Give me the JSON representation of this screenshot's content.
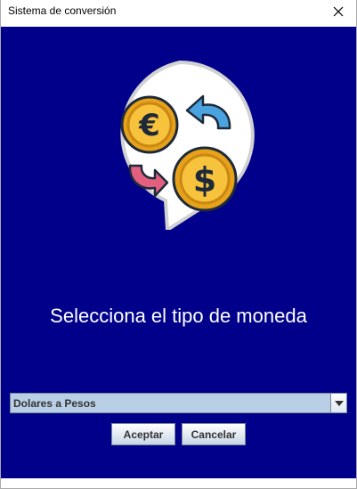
{
  "window": {
    "title": "Sistema de conversión"
  },
  "logo": {
    "icon": "currency-exchange-icon",
    "euro_symbol": "€",
    "dollar_symbol": "$"
  },
  "main": {
    "prompt": "Selecciona el tipo de moneda"
  },
  "conversion_select": {
    "selected": "Dolares a Pesos"
  },
  "buttons": {
    "accept_label": "Aceptar",
    "cancel_label": "Cancelar"
  },
  "colors": {
    "background": "#00008b",
    "combo_background": "#b8cfe5",
    "coin_gold": "#f2b021",
    "arrow_blue": "#4aa3df",
    "arrow_pink": "#e25f80"
  }
}
